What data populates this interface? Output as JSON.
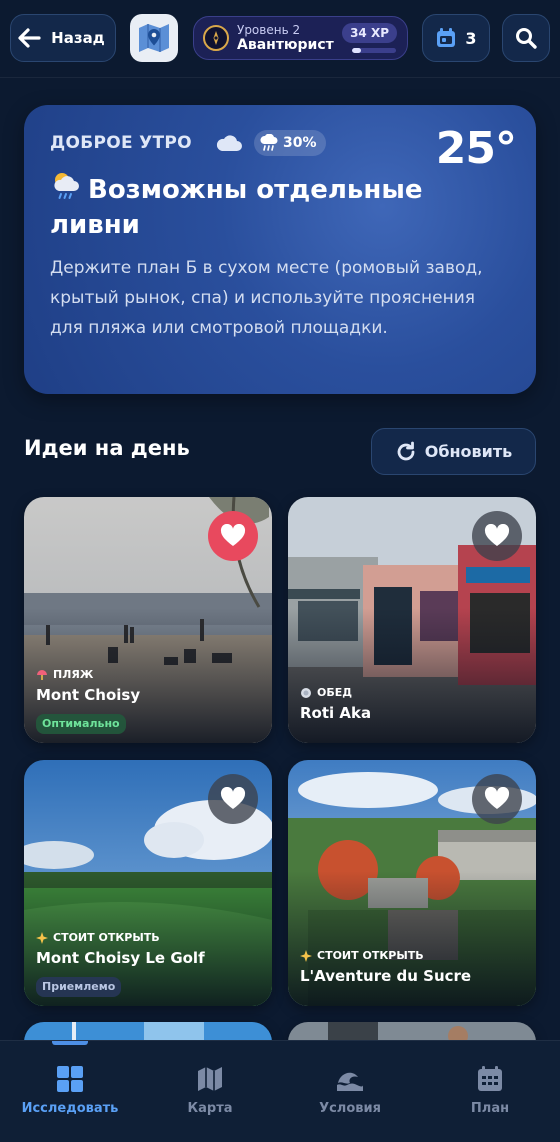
{
  "header": {
    "back_label": "Назад",
    "level_label": "Уровень 2",
    "level_name": "Авантюрист",
    "xp_label": "34 XP",
    "xp_progress": 0.2,
    "calendar_count": "3"
  },
  "weather": {
    "greeting": "ДОБРОЕ УТРО",
    "rain_chance": "30%",
    "temperature": "25°",
    "title": "Возможны отдельные ливни",
    "description": "Держите план Б в сухом месте (ромовый завод, крытый рынок, спа) и используйте прояснения для пляжа или смотровой площадки."
  },
  "ideas": {
    "title": "Идеи на день",
    "refresh_label": "Обновить",
    "cards": [
      {
        "category": "ПЛЯЖ",
        "category_icon": "umbrella-icon",
        "name": "Mont Choisy",
        "status": "Оптимально",
        "favorite": true
      },
      {
        "category": "ОБЕД",
        "category_icon": "plate-icon",
        "name": "Roti Aka",
        "status": null,
        "favorite": false
      },
      {
        "category": "СТОИТ ОТКРЫТЬ",
        "category_icon": "sparkle-icon",
        "name": "Mont Choisy Le Golf",
        "status": "Приемлемо",
        "favorite": false
      },
      {
        "category": "СТОИТ ОТКРЫТЬ",
        "category_icon": "sparkle-icon",
        "name": "L'Aventure du Sucre",
        "status": null,
        "favorite": false
      }
    ]
  },
  "nav": {
    "items": [
      {
        "label": "Исследовать",
        "icon": "grid-icon",
        "active": true
      },
      {
        "label": "Карта",
        "icon": "map-icon",
        "active": false
      },
      {
        "label": "Условия",
        "icon": "wave-icon",
        "active": false
      },
      {
        "label": "План",
        "icon": "calendar-icon",
        "active": false
      }
    ]
  },
  "colors": {
    "background": "#0c1a30",
    "accent": "#5aa0f5",
    "favorite_active": "#e8495e",
    "status_good": "#6ee39a"
  }
}
